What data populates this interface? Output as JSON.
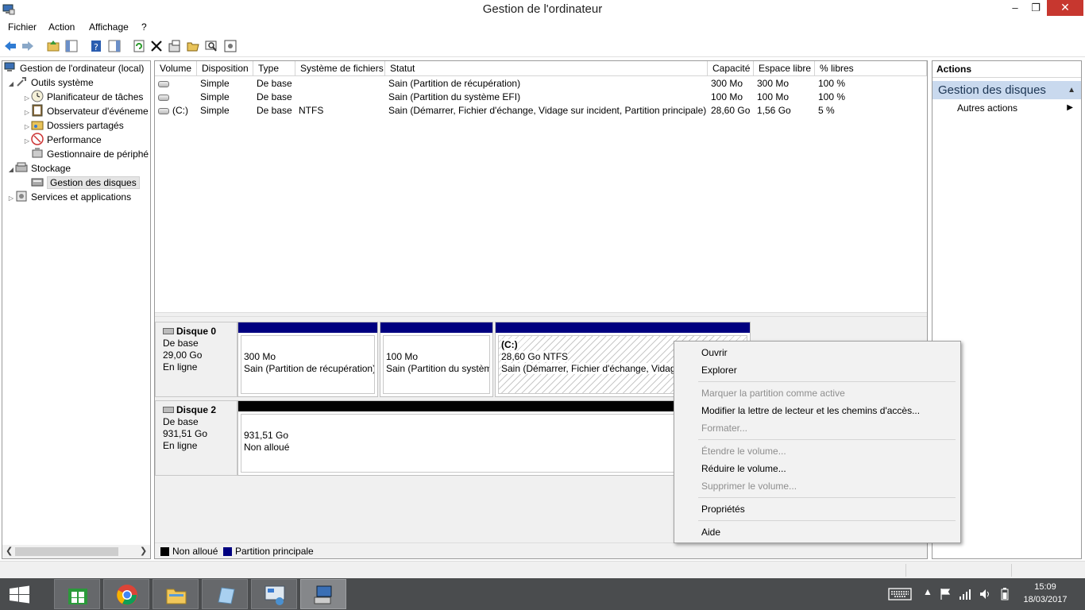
{
  "window": {
    "title": "Gestion de l'ordinateur",
    "minimize": "‒",
    "maximize": "❐",
    "close": "✕"
  },
  "menu": [
    "Fichier",
    "Action",
    "Affichage",
    "?"
  ],
  "tree": {
    "root": "Gestion de l'ordinateur (local)",
    "system_tools": "Outils système",
    "task_scheduler": "Planificateur de tâches",
    "event_viewer": "Observateur d'événeme",
    "shared_folders": "Dossiers partagés",
    "performance": "Performance",
    "device_manager": "Gestionnaire de périphé",
    "storage": "Stockage",
    "disk_management": "Gestion des disques",
    "services": "Services et applications"
  },
  "table": {
    "headers": [
      "Volume",
      "Disposition",
      "Type",
      "Système de fichiers",
      "Statut",
      "Capacité",
      "Espace libre",
      "% libres"
    ],
    "rows": [
      [
        "",
        "Simple",
        "De base",
        "",
        "Sain (Partition de récupération)",
        "300 Mo",
        "300 Mo",
        "100 %"
      ],
      [
        "",
        "Simple",
        "De base",
        "",
        "Sain (Partition du système EFI)",
        "100 Mo",
        "100 Mo",
        "100 %"
      ],
      [
        "(C:)",
        "Simple",
        "De base",
        "NTFS",
        "Sain (Démarrer, Fichier d'échange, Vidage sur incident, Partition principale)",
        "28,60 Go",
        "1,56 Go",
        "5 %"
      ]
    ]
  },
  "disks": [
    {
      "name": "Disque 0",
      "type": "De base",
      "size": "29,00 Go",
      "status": "En ligne",
      "partitions": [
        {
          "title": "",
          "size": "300 Mo",
          "status": "Sain (Partition de récupération)"
        },
        {
          "title": "",
          "size": "100 Mo",
          "status": "Sain (Partition du systèm"
        },
        {
          "title": "(C:)",
          "size": "28,60 Go NTFS",
          "status": "Sain (Démarrer, Fichier d'échange, Vidage"
        }
      ]
    },
    {
      "name": "Disque 2",
      "type": "De base",
      "size": "931,51 Go",
      "status": "En ligne",
      "partitions": [
        {
          "title": "",
          "size": "931,51 Go",
          "status": "Non alloué"
        }
      ]
    }
  ],
  "legend": {
    "unallocated": "Non alloué",
    "primary": "Partition principale"
  },
  "actions": {
    "header": "Actions",
    "section": "Gestion des disques",
    "more": "Autres actions"
  },
  "context_menu": {
    "open": "Ouvrir",
    "explore": "Explorer",
    "mark_active": "Marquer la partition comme active",
    "change_letter": "Modifier la lettre de lecteur et les chemins d'accès...",
    "format": "Formater...",
    "extend": "Étendre le volume...",
    "shrink": "Réduire le volume...",
    "delete": "Supprimer le volume...",
    "properties": "Propriétés",
    "help": "Aide"
  },
  "taskbar": {
    "time": "15:09",
    "date": "18/03/2017"
  },
  "colors": {
    "primary_partition": "#000080",
    "unallocated": "#000000",
    "actions_section_bg": "#c9d9ee",
    "close_button": "#c7372f",
    "taskbar": "#4a4c4e"
  }
}
